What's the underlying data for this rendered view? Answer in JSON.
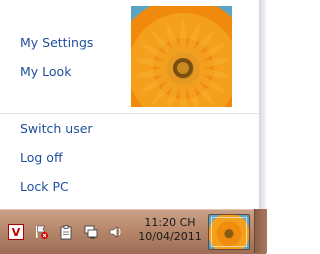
{
  "menu": {
    "items_top": [
      {
        "label": "My Settings"
      },
      {
        "label": "My Look"
      }
    ],
    "items_bottom": [
      {
        "label": "Switch user"
      },
      {
        "label": "Log off"
      },
      {
        "label": "Lock PC"
      }
    ],
    "link_color": "#1f4e9e"
  },
  "taskbar": {
    "clock_time": "11:20 CH",
    "clock_date": "10/04/2011",
    "tray_icons": [
      "antivirus-icon",
      "action-center-flag-icon",
      "clipboard-icon",
      "network-icon",
      "speaker-icon"
    ],
    "background": "#b7876c"
  }
}
